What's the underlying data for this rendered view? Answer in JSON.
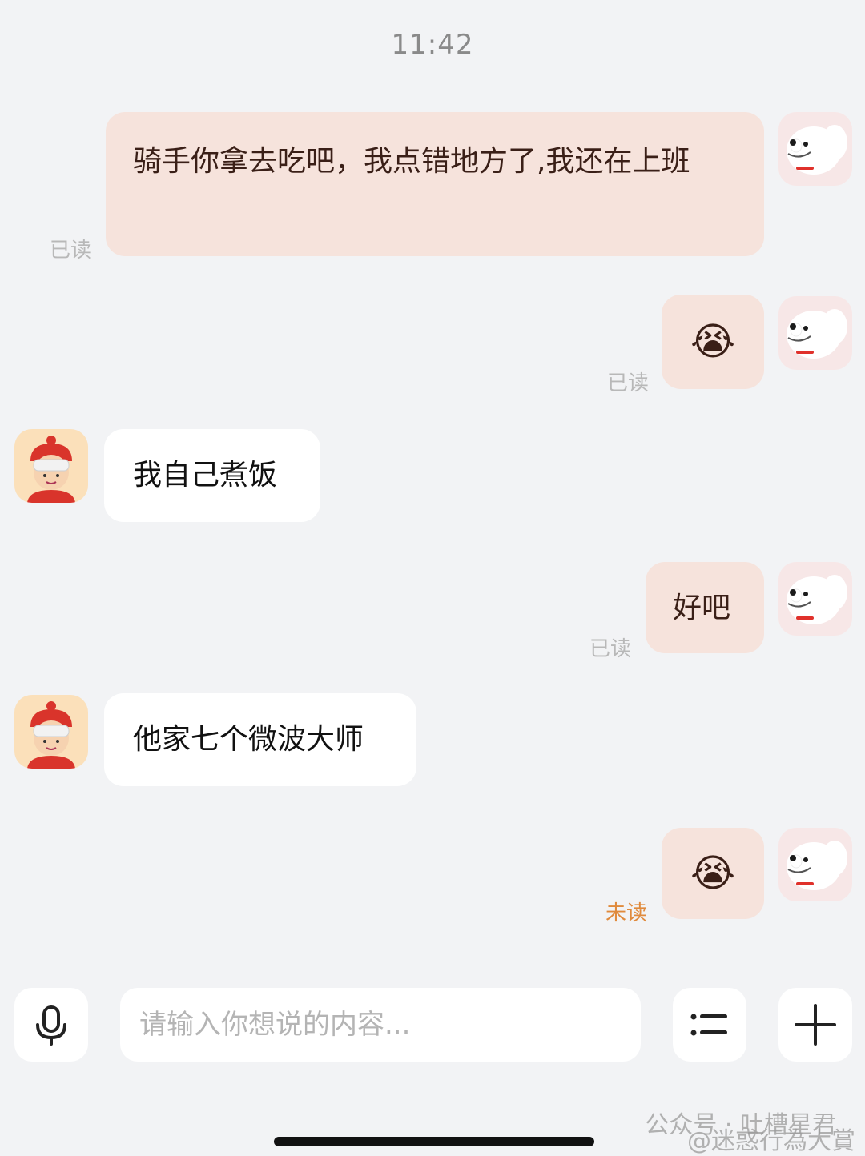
{
  "status": {
    "time": "11:42"
  },
  "messages": [
    {
      "direction": "sent",
      "text": "骑手你拿去吃吧，我点错地方了,我还在上班",
      "status": "已读"
    },
    {
      "direction": "sent",
      "emoji": "😭",
      "status": "已读"
    },
    {
      "direction": "received",
      "text": "我自己煮饭"
    },
    {
      "direction": "sent",
      "text": "好吧",
      "status": "已读"
    },
    {
      "direction": "received",
      "text": "他家七个微波大师"
    },
    {
      "direction": "sent",
      "emoji": "😭",
      "status": "未读"
    }
  ],
  "input": {
    "placeholder": "请输入你想说的内容..."
  },
  "icons": {
    "voice": "microphone-icon",
    "menu": "list-icon",
    "more": "plus-icon"
  },
  "watermark": {
    "line1": "公众号 · 吐槽星君",
    "line2": "@迷惑行為大賞"
  },
  "colors": {
    "background": "#f2f3f5",
    "sent_bubble": "#f6e3dc",
    "received_bubble": "#ffffff",
    "unread": "#e08a3c"
  }
}
